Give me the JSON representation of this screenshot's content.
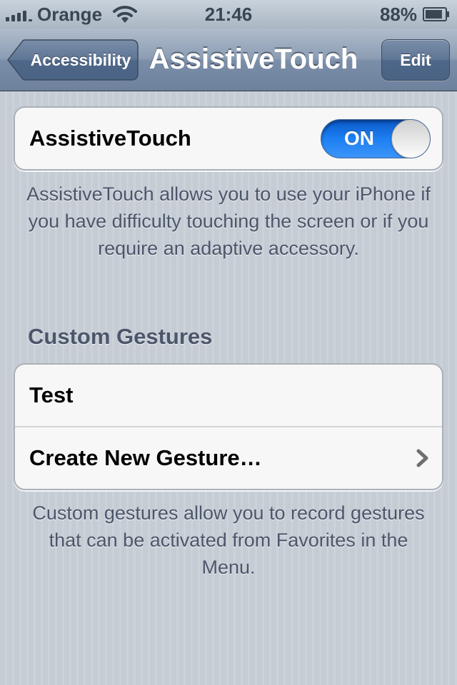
{
  "status_bar": {
    "carrier": "Orange",
    "time": "21:46",
    "battery_percent": "88%",
    "battery_level": 0.88
  },
  "nav_bar": {
    "back_label": "Accessibility",
    "title": "AssistiveTouch",
    "edit_label": "Edit"
  },
  "assistive_touch": {
    "label": "AssistiveTouch",
    "toggle_text": "ON",
    "enabled": true,
    "footer": "AssistiveTouch allows you to use your iPhone if you have difficulty touching the screen or if you require an adaptive accessory."
  },
  "custom_gestures": {
    "header": "Custom Gestures",
    "items": [
      {
        "label": "Test",
        "chevron": false
      },
      {
        "label": "Create New Gesture…",
        "chevron": true
      }
    ],
    "footer": "Custom gestures allow you to record gestures that can be activated from Favorites in the Menu."
  },
  "colors": {
    "toggle_on": "#1c7ff3",
    "nav_bar": "#8c9db4"
  },
  "icons": {
    "signal": "signal-bars-icon",
    "wifi": "wifi-icon",
    "battery": "battery-icon",
    "chevron": "chevron-right-icon"
  }
}
